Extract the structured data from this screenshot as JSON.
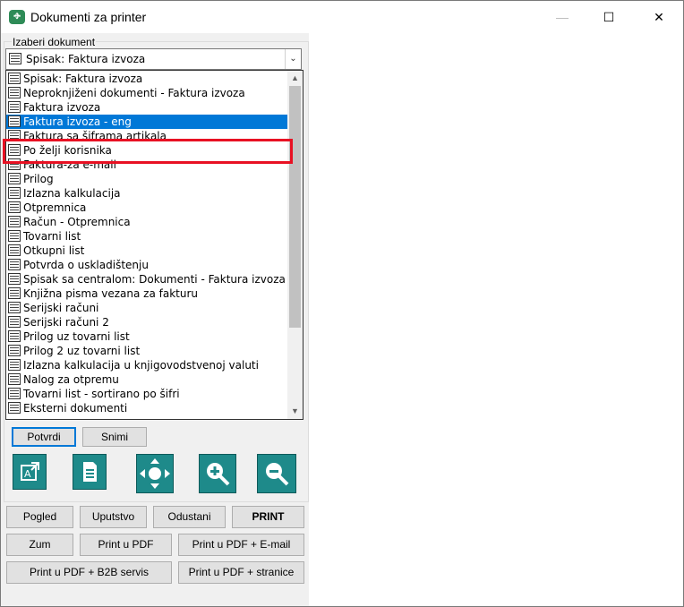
{
  "window": {
    "title": "Dokumenti za printer",
    "minimize_glyph": "—",
    "maximize_glyph": "☐",
    "close_glyph": "✕"
  },
  "group": {
    "label": "Izaberi dokument"
  },
  "combo": {
    "selected": "Spisak: Faktura izvoza",
    "arrow": "⌄"
  },
  "dropdown": {
    "items": [
      "Spisak: Faktura izvoza",
      "Neproknjiženi dokumenti - Faktura izvoza",
      "Faktura izvoza",
      "Faktura izvoza - eng",
      "Faktura sa šiframa artikala",
      "Po želji korisnika",
      "Faktura-za e-mail",
      "Prilog",
      "Izlazna kalkulacija",
      "Otpremnica",
      "Račun - Otpremnica",
      "Tovarni list",
      "Otkupni list",
      "Potvrda o uskladištenju",
      "Spisak sa centralom: Dokumenti - Faktura izvoza",
      "Knjižna pisma vezana za fakturu",
      "Serijski računi",
      "Serijski računi 2",
      "Prilog uz tovarni list",
      "Prilog 2 uz tovarni list",
      "Izlazna kalkulacija u knjigovodstvenoj valuti",
      "Nalog za otpremu",
      "Tovarni list - sortirano po šifri",
      "Eksterni dokumenti"
    ],
    "selected_index": 3
  },
  "actions": {
    "confirm": "Potvrdi",
    "save": "Snimi"
  },
  "tools": {
    "icons": [
      "export-icon",
      "document-icon",
      "move-icon",
      "zoom-in-icon",
      "zoom-out-icon"
    ]
  },
  "bottom": {
    "row1": [
      "Pogled",
      "Uputstvo",
      "Odustani",
      "PRINT"
    ],
    "row2": [
      "Zum",
      "Print u PDF",
      "Print u PDF + E-mail"
    ],
    "row3": [
      "Print u PDF + B2B servis",
      "Print u PDF + stranice"
    ]
  },
  "colors": {
    "selection": "#0078d7",
    "highlight": "#e81123",
    "tool": "#1e8a8a"
  }
}
